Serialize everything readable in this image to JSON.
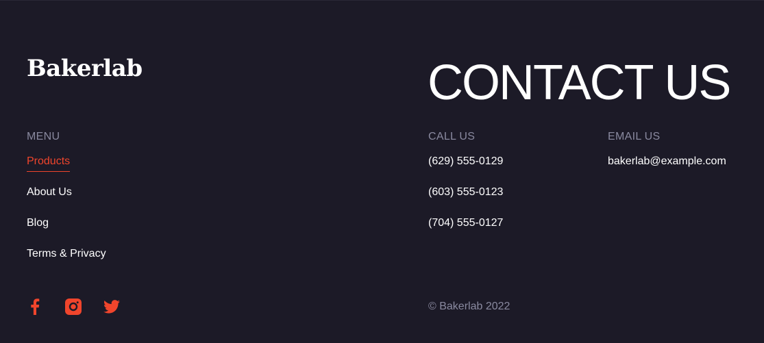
{
  "brand": {
    "logo_text": "Bakerlab"
  },
  "contact": {
    "title": "CONTACT US",
    "call_label": "CALL US",
    "phones": [
      "(629) 555-0129",
      "(603) 555-0123",
      "(704) 555-0127"
    ],
    "email_label": "EMAIL US",
    "email": "bakerlab@example.com"
  },
  "menu": {
    "label": "MENU",
    "items": [
      {
        "label": "Products",
        "active": true
      },
      {
        "label": "About Us",
        "active": false
      },
      {
        "label": "Blog",
        "active": false
      },
      {
        "label": "Terms & Privacy",
        "active": false
      }
    ]
  },
  "social": {
    "icons": [
      "facebook-icon",
      "instagram-icon",
      "twitter-icon"
    ]
  },
  "copyright": "© Bakerlab 2022",
  "colors": {
    "background": "#1c1a27",
    "accent": "#f0452c",
    "muted_text": "#8a8aa0",
    "text": "#ffffff"
  }
}
